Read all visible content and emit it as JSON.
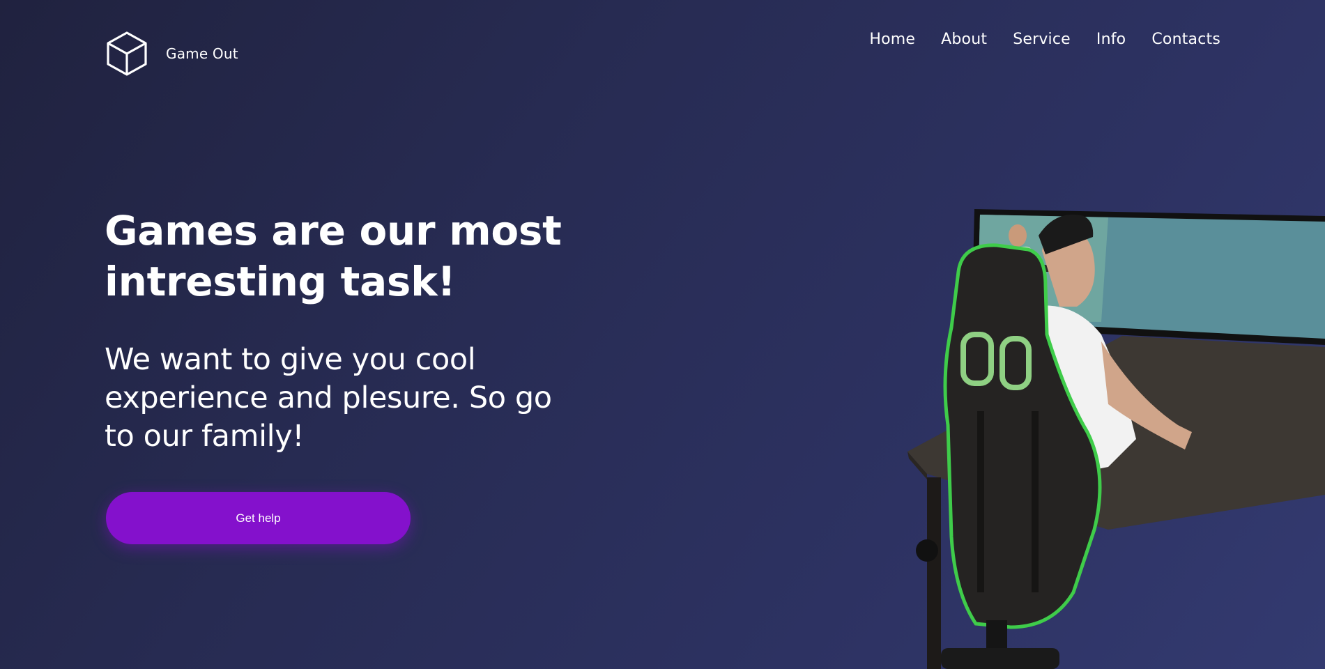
{
  "brand": {
    "name": "Game Out",
    "icon": "cube-icon"
  },
  "nav": {
    "items": [
      {
        "label": "Home"
      },
      {
        "label": "About"
      },
      {
        "label": "Service"
      },
      {
        "label": "Info"
      },
      {
        "label": "Contacts"
      }
    ]
  },
  "hero": {
    "title": "Games are our most intresting task!",
    "subtitle": "We want to give you cool experience and plesure. So go to our family!",
    "cta_label": "Get help",
    "image": "gamer-at-desk-illustration"
  },
  "colors": {
    "background_start": "#20223f",
    "background_end": "#333a70",
    "accent": "#8411cc",
    "text": "#ffffff",
    "chair_trim": "#3fcc4a"
  }
}
